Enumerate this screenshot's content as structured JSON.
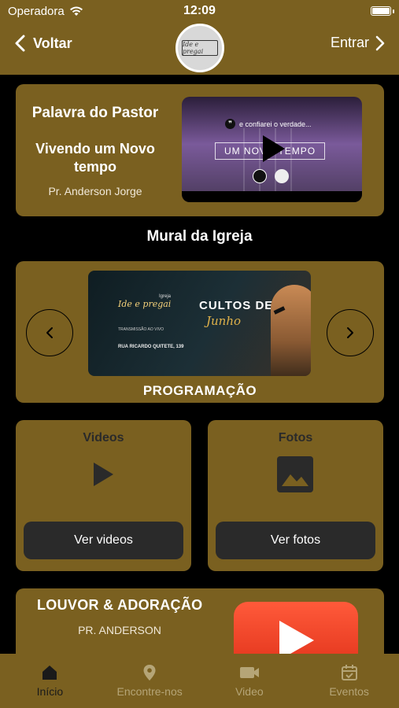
{
  "status_bar": {
    "carrier": "Operadora",
    "time": "12:09"
  },
  "nav": {
    "back_label": "Voltar",
    "enter_label": "Entrar",
    "logo_text": "Ide e pregai"
  },
  "pastor_card": {
    "section_title": "Palavra do Pastor",
    "sermon_title_line1": "Vivendo um Novo",
    "sermon_title_line2": "tempo",
    "pastor_name": "Pr. Anderson Jorge",
    "video": {
      "quote": "e confiarei o verdade...",
      "headline": "UM NOVO TEMPO"
    }
  },
  "mural": {
    "title": "Mural da Igreja"
  },
  "carousel": {
    "caption": "PROGRAMAÇÃO",
    "banner": {
      "church_small": "Igreja",
      "church_name": "Ide e pregai",
      "title": "CULTOS DE",
      "month": "Junho",
      "live_text": "TRANSMISSÃO AO VIVO",
      "address": "RUA RICARDO QUITETE, 139"
    }
  },
  "media": {
    "videos": {
      "title": "Videos",
      "button": "Ver videos"
    },
    "photos": {
      "title": "Fotos",
      "button": "Ver fotos"
    }
  },
  "louvor": {
    "title": "LOUVOR & ADORAÇÃO",
    "subtitle": "PR. ANDERSON"
  },
  "tabbar": {
    "tabs": [
      {
        "label": "Início",
        "icon": "home-icon",
        "active": true
      },
      {
        "label": "Encontre-nos",
        "icon": "location-pin-icon",
        "active": false
      },
      {
        "label": "Video",
        "icon": "video-camera-icon",
        "active": false
      },
      {
        "label": "Eventos",
        "icon": "calendar-icon",
        "active": false
      }
    ]
  },
  "colors": {
    "brand_gold": "#7a6020",
    "background": "#000000",
    "button_dark": "#2a2a2a",
    "tab_inactive": "#b5a577",
    "youtube_red": "#e0321a"
  }
}
